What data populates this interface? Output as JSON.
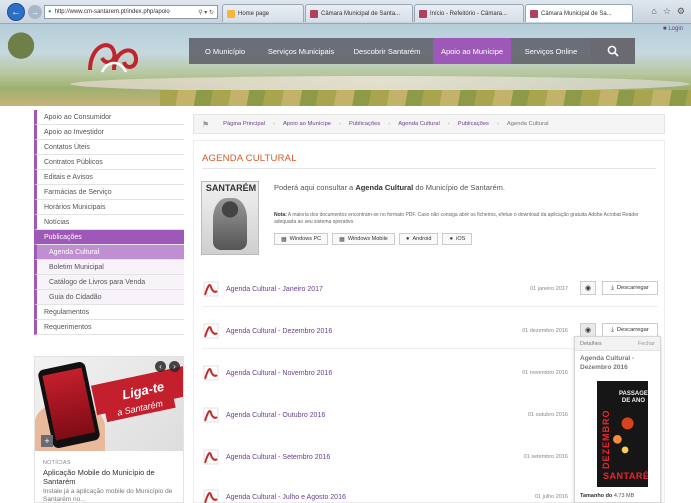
{
  "browser": {
    "address": "http://www.cm-santarem.pt/index.php/apoio",
    "tabs": [
      {
        "label": "Home page"
      },
      {
        "label": "Câmara Municipal de Santa..."
      },
      {
        "label": "Início - Refeitório - Câmara..."
      },
      {
        "label": "Câmara Municipal de Sa..."
      }
    ]
  },
  "header": {
    "login": "Login",
    "menu": [
      {
        "label": "O Município"
      },
      {
        "label": "Serviços Municipais"
      },
      {
        "label": "Descobrir Santarém"
      },
      {
        "label": "Apoio ao Munícipe"
      },
      {
        "label": "Serviços Online"
      }
    ]
  },
  "sidebar": {
    "items": [
      {
        "label": "Apoio ao Consumidor"
      },
      {
        "label": "Apoio ao Investidor"
      },
      {
        "label": "Contatos Úteis"
      },
      {
        "label": "Contratos Públicos"
      },
      {
        "label": "Editais e Avisos"
      },
      {
        "label": "Farmácias de Serviço"
      },
      {
        "label": "Horários Municipais"
      },
      {
        "label": "Notícias"
      },
      {
        "label": "Publicações"
      },
      {
        "label": "Agenda Cultural"
      },
      {
        "label": "Boletim Municipal"
      },
      {
        "label": "Catálogo de Livros para Venda"
      },
      {
        "label": "Guia do Cidadão"
      },
      {
        "label": "Regulamentos"
      },
      {
        "label": "Requerimentos"
      }
    ]
  },
  "promo": {
    "headline": "Liga-te",
    "subline": "a Santarém",
    "category": "NOTÍCIAS",
    "title": "Aplicação Mobile do Município de Santarém",
    "text": "Instale já a aplicação mobile do Município de Santarém no..."
  },
  "breadcrumb": {
    "items": [
      "Página Principal",
      "Apoio ao Munícipe",
      "Publicações",
      "Agenda Cultural",
      "Publicações",
      "Agenda Cultural"
    ]
  },
  "main": {
    "title": "AGENDA CULTURAL",
    "cover_title": "SANTARÉM",
    "intro_pre": "Poderá aqui consultar a ",
    "intro_bold": "Agenda Cultural",
    "intro_post": " do Município de Santarém.",
    "note_label": "Nota:",
    "note_text": " A maioria dos documentos encontram-se no formato PDF. Caso não consiga abrir os ficheiros, efetue o download da aplicação gratuita Adobe Acrobat Reader adequada ao seu sistema operativo.",
    "os_buttons": [
      {
        "label": "Windows PC"
      },
      {
        "label": "Windows Mobile"
      },
      {
        "label": "Android"
      },
      {
        "label": "iOS"
      }
    ],
    "documents": [
      {
        "title": "Agenda Cultural - Janeiro 2017",
        "date": "01 janeiro 2017"
      },
      {
        "title": "Agenda Cultural - Dezembro 2016",
        "date": "01 dezembro 2016"
      },
      {
        "title": "Agenda Cultural - Novembro 2016",
        "date": "01 novembro 2016"
      },
      {
        "title": "Agenda Cultural - Outubro 2016",
        "date": "01 outubro 2016"
      },
      {
        "title": "Agenda Cultural - Setembro 2016",
        "date": "01 setembro 2016"
      },
      {
        "title": "Agenda Cultural - Julho e Agosto 2016",
        "date": "01 julho 2016"
      }
    ],
    "download_label": "Descarregar"
  },
  "details": {
    "label": "Detalhes",
    "close": "Fechar",
    "title": "Agenda Cultural - Dezembro 2016",
    "cover_text": "PASSAGEM DE ANO",
    "cover_vertical": "DEZEMBRO",
    "cover_brand": "SANTARÉM",
    "size_label": "Tamanho do",
    "size_value": "4.73 MB"
  },
  "colors": {
    "accent": "#9d58b8",
    "title": "#d45a2c",
    "link": "#6b3d8f"
  }
}
